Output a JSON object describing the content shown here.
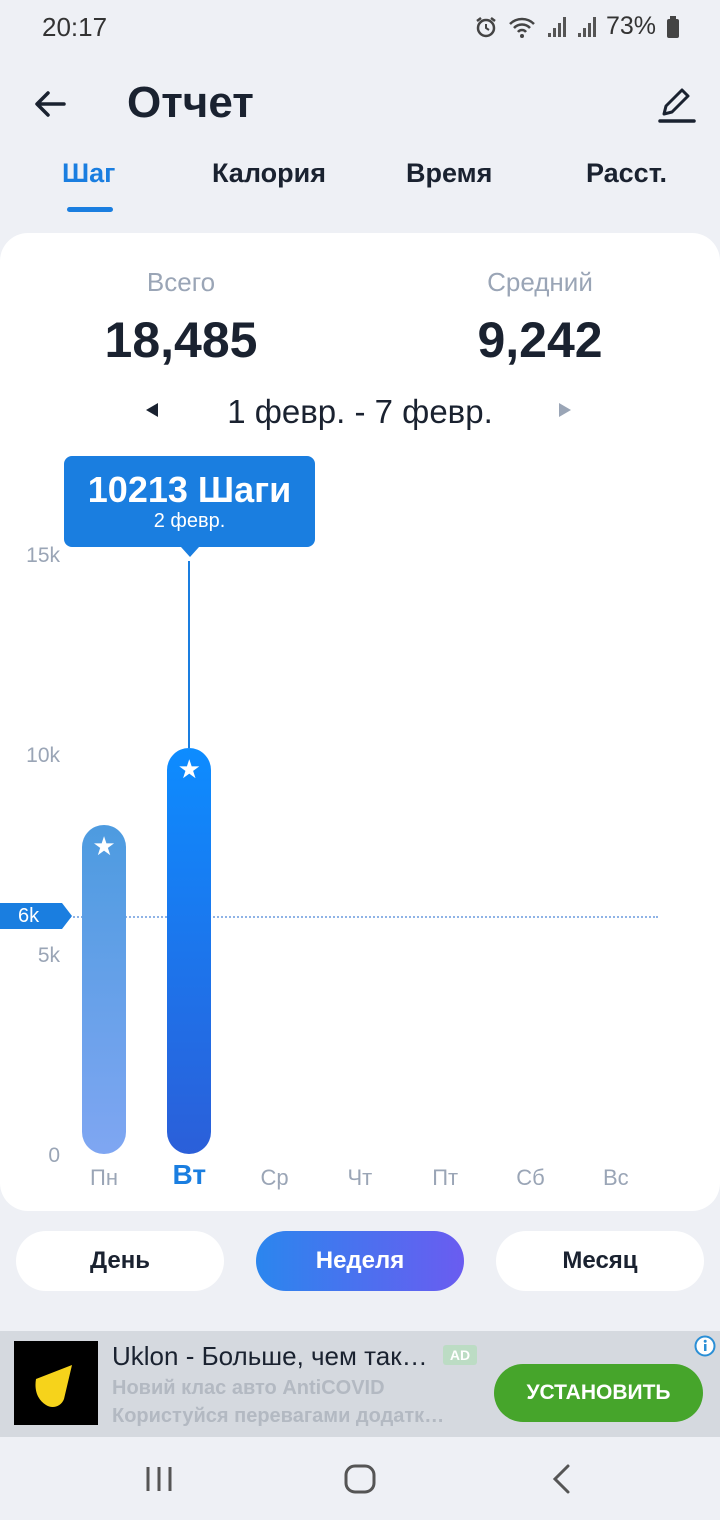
{
  "status_bar": {
    "time": "20:17",
    "battery": "73%",
    "icons": [
      "alarm-icon",
      "wifi-icon",
      "signal-icon",
      "signal-icon",
      "battery-icon"
    ]
  },
  "header": {
    "title": "Отчет",
    "back_icon": "arrow-left-icon",
    "edit_icon": "pencil-icon"
  },
  "tabs": [
    {
      "label": "Шаг",
      "active": true
    },
    {
      "label": "Калория",
      "active": false
    },
    {
      "label": "Время",
      "active": false
    },
    {
      "label": "Расст.",
      "active": false
    }
  ],
  "summary": {
    "total_label": "Всего",
    "total_value": "18,485",
    "average_label": "Средний",
    "average_value": "9,242"
  },
  "date_range": "1 февр. - 7 февр.",
  "tooltip": {
    "value": "10213 Шаги",
    "date": "2 февр."
  },
  "goal_marker": "6k",
  "colors": {
    "accent": "#1a7ee0",
    "muted": "#9aa5b6",
    "cta_green": "#46a52b"
  },
  "chart_data": {
    "type": "bar",
    "categories": [
      "Пн",
      "Вт",
      "Ср",
      "Чт",
      "Пт",
      "Сб",
      "Вс"
    ],
    "values": [
      8272,
      10213,
      0,
      0,
      0,
      0,
      0
    ],
    "selected_category": "Вт",
    "y_ticks": [
      "0",
      "5k",
      "10k",
      "15k"
    ],
    "ylim": [
      0,
      15000
    ],
    "reference_line": 6000,
    "grid": false
  },
  "periods": [
    {
      "label": "День",
      "active": false
    },
    {
      "label": "Неделя",
      "active": true
    },
    {
      "label": "Месяц",
      "active": false
    }
  ],
  "ad": {
    "title": "Uklon - Больше, чем так…",
    "badge": "AD",
    "line1": "Новий клас авто AntiCOVID",
    "line2": "Користуйся перевагами додатк…",
    "cta": "УСТАНОВИТЬ"
  },
  "navbar": {
    "icons": [
      "recent-apps-icon",
      "home-icon",
      "back-icon"
    ]
  }
}
